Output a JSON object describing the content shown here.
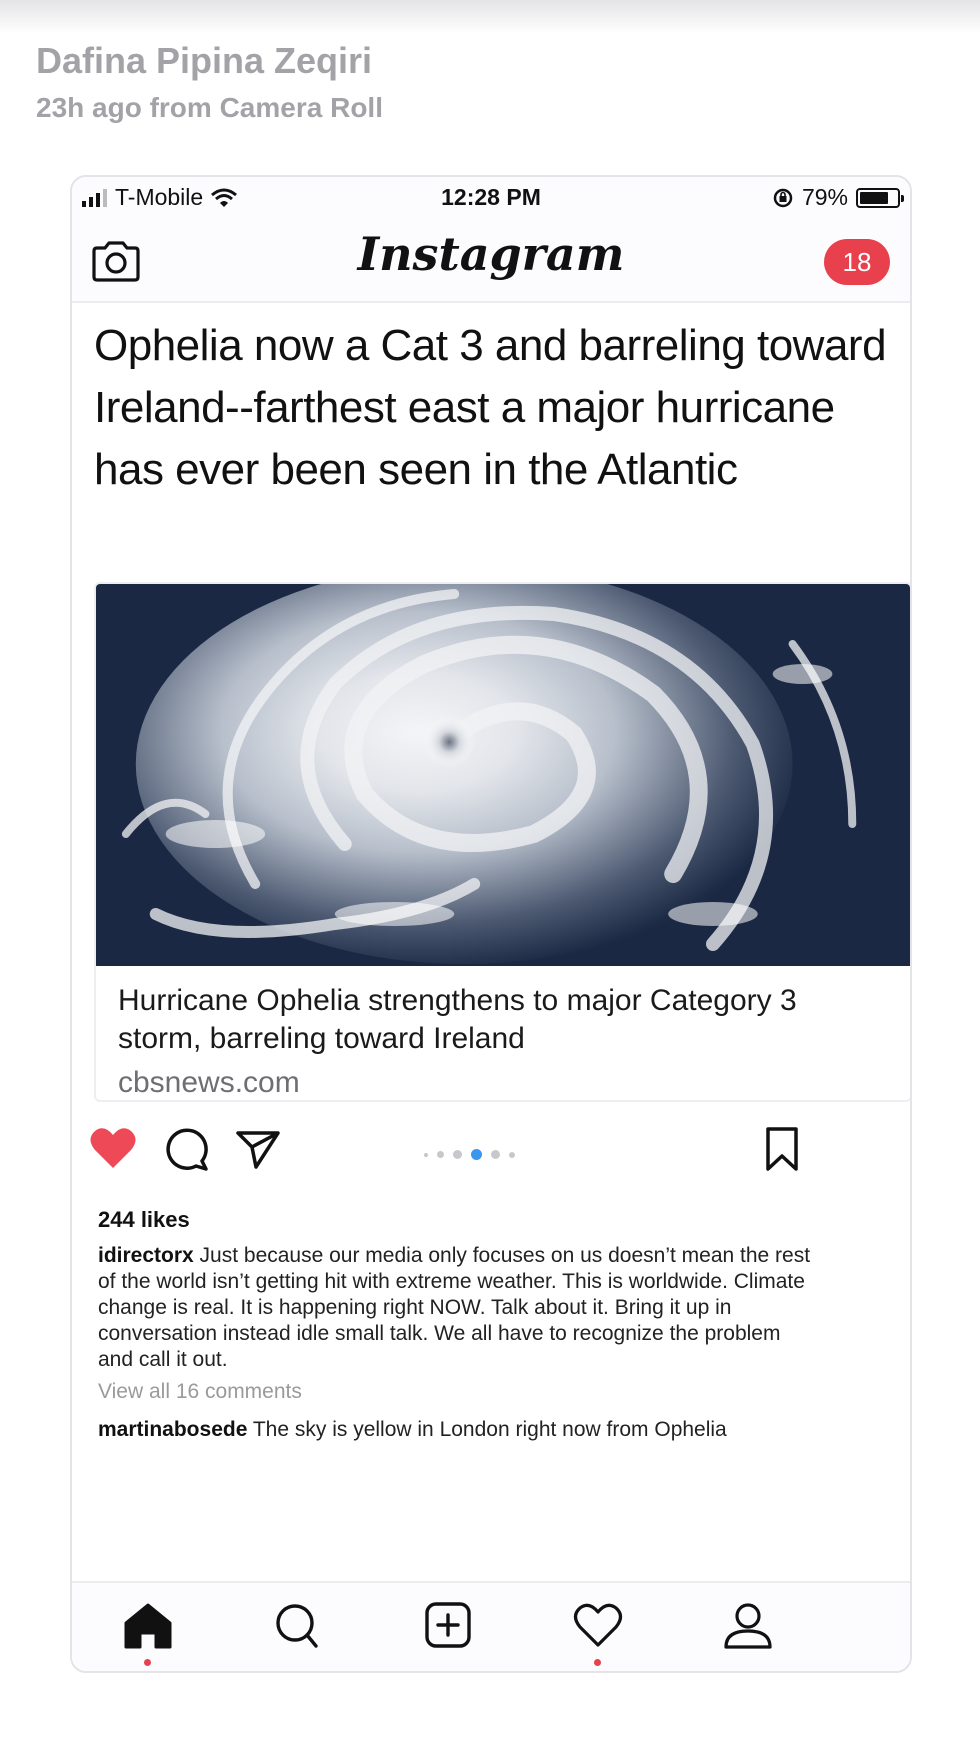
{
  "post_header": {
    "name": "Dafina Pipina Zeqiri",
    "meta": "23h ago from Camera Roll"
  },
  "status_bar": {
    "carrier": "T-Mobile",
    "time": "12:28 PM",
    "battery": "79%",
    "battery_level": 0.79,
    "icons": [
      "signal-icon",
      "wifi-icon",
      "rotation-lock-icon",
      "battery-icon"
    ]
  },
  "app_header": {
    "logo_text": "Instagram",
    "notification_count": "18",
    "badge_color": "#e8404d",
    "icons": [
      "camera-icon"
    ]
  },
  "post": {
    "headline": "Ophelia now a Cat 3 and barreling toward Ireland--farthest east a major hurricane has ever been seen in the Atlantic",
    "link_card": {
      "title": "Hurricane Ophelia strengthens to major Category 3 storm, barreling toward Ireland",
      "domain": "cbsnews.com",
      "image": "hurricane-satellite-image"
    },
    "actions": {
      "icons": [
        "heart-filled-icon",
        "comment-icon",
        "share-icon",
        "bookmark-icon"
      ],
      "like_color": "#ed4956",
      "carousel_active_index": 3,
      "carousel_count": 6,
      "carousel_active_color": "#3897f0"
    },
    "likes": "244 likes",
    "caption": {
      "username": "idirectorx",
      "text": " Just because our media only focuses on us doesn’t mean the rest of the world isn’t getting hit with extreme weather. This is worldwide. Climate change is real. It is happening right NOW. Talk about it. Bring it up in conversation instead idle small talk. We all have to recognize the problem and call it out."
    },
    "view_comments": "View all 16 comments",
    "comment": {
      "username": "martinabosede",
      "text": " The sky is yellow in London right now from Ophelia"
    }
  },
  "tab_bar": {
    "icons": [
      "home-icon",
      "search-icon",
      "add-post-icon",
      "activity-heart-icon",
      "profile-icon"
    ],
    "dot_color": "#e8404d"
  }
}
